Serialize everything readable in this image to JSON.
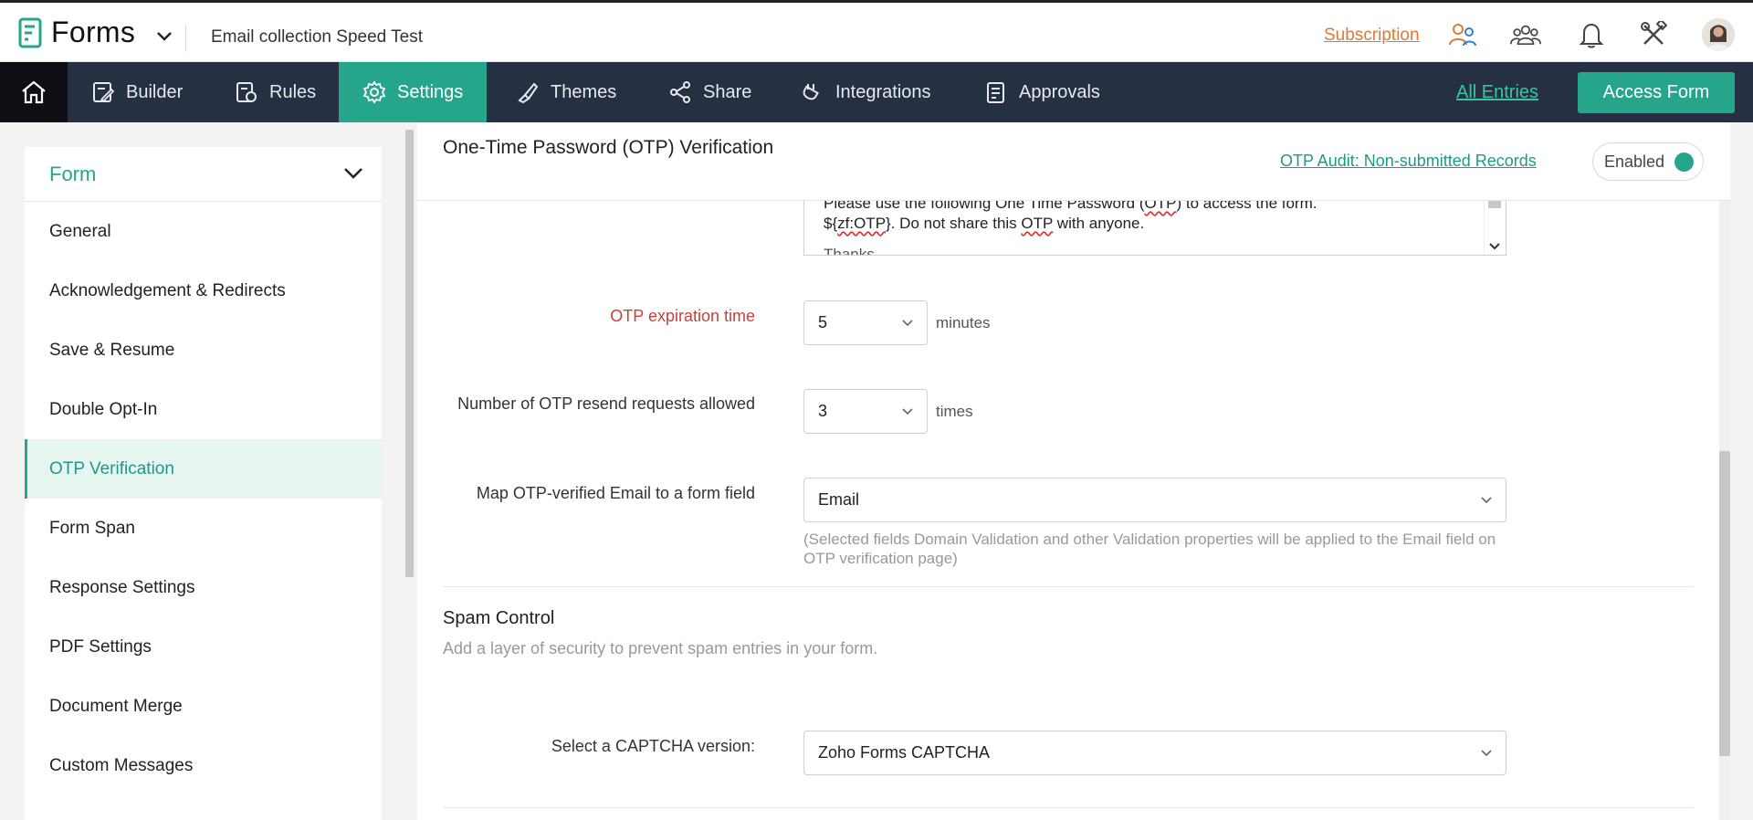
{
  "app": {
    "name": "Forms",
    "form_title": "Email collection Speed Test"
  },
  "topbar": {
    "subscription_label": "Subscription",
    "icons": [
      "switch-user-icon",
      "users-icon",
      "bell-icon",
      "tools-icon",
      "avatar"
    ]
  },
  "nav": {
    "items": [
      {
        "label": "Builder",
        "icon": "builder-icon"
      },
      {
        "label": "Rules",
        "icon": "rules-icon"
      },
      {
        "label": "Settings",
        "icon": "gear-icon",
        "active": true
      },
      {
        "label": "Themes",
        "icon": "brush-icon"
      },
      {
        "label": "Share",
        "icon": "share-icon"
      },
      {
        "label": "Integrations",
        "icon": "plug-icon"
      },
      {
        "label": "Approvals",
        "icon": "approvals-icon"
      }
    ],
    "all_entries_label": "All Entries",
    "access_form_label": "Access Form"
  },
  "sidebar": {
    "header": "Form",
    "items": [
      {
        "label": "General"
      },
      {
        "label": "Acknowledgement & Redirects"
      },
      {
        "label": "Save & Resume"
      },
      {
        "label": "Double Opt-In"
      },
      {
        "label": "OTP Verification",
        "active": true
      },
      {
        "label": "Form Span"
      },
      {
        "label": "Response Settings"
      },
      {
        "label": "PDF Settings"
      },
      {
        "label": "Document Merge"
      },
      {
        "label": "Custom Messages"
      }
    ]
  },
  "main": {
    "title": "One-Time Password (OTP) Verification",
    "audit_link": "OTP Audit: Non-submitted Records",
    "toggle_label": "Enabled",
    "message": {
      "line1_pre": "Please use the following One Time Password (",
      "line1_otp": "OTP",
      "line1_post": ") to access the form.",
      "line2_pre": "${",
      "line2_var": "zf:OTP",
      "line2_mid": "}. Do not share this ",
      "line2_otp": "OTP",
      "line2_post": " with anyone.",
      "line3": "Thanks"
    },
    "otp_expiration": {
      "label": "OTP expiration time",
      "value": "5",
      "unit": "minutes"
    },
    "resend": {
      "label": "Number of OTP resend requests allowed",
      "value": "3",
      "unit": "times"
    },
    "map_email": {
      "label": "Map OTP-verified Email to a form field",
      "value": "Email",
      "helper": "(Selected fields Domain Validation and other Validation properties will be applied to the Email field on OTP verification page)"
    },
    "spam": {
      "title": "Spam Control",
      "description": "Add a layer of security to prevent spam entries in your form.",
      "captcha_label": "Select a CAPTCHA version:",
      "captcha_value": "Zoho Forms CAPTCHA"
    }
  },
  "colors": {
    "accent": "#25a68c",
    "nav_bg": "#253042",
    "subscription": "#e0783a",
    "error_label": "#c6423b"
  }
}
